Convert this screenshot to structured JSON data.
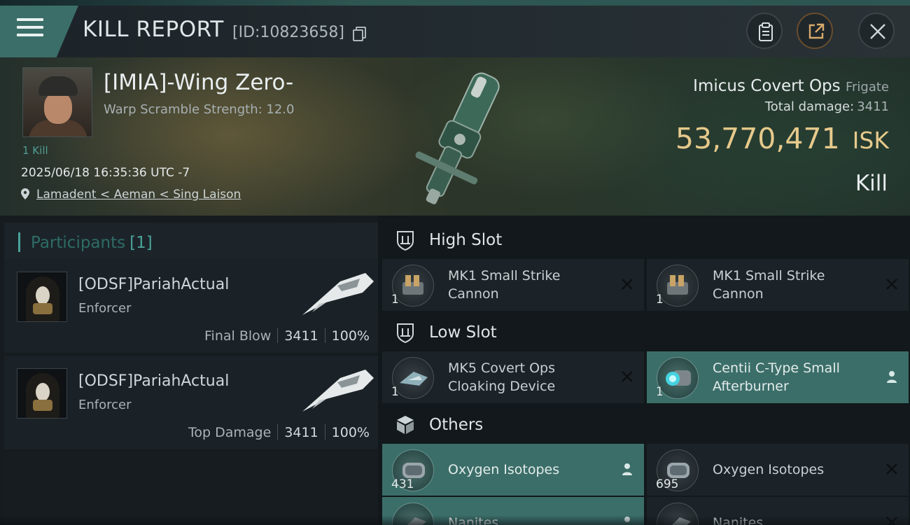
{
  "header": {
    "title": "KILL REPORT",
    "report_id": "[ID:10823658]"
  },
  "victim": {
    "name": "[IMIA]-Wing Zero-",
    "warp_scramble": "Warp Scramble Strength: 12.0",
    "kill_count": "1 Kill",
    "datetime": "2025/06/18 16:35:36 UTC -7",
    "location": "Lamadent < Aeman < Sing Laison"
  },
  "ship": {
    "name": "Imicus Covert Ops",
    "class": "Frigate",
    "damage_label": "Total damage:",
    "damage_value": "3411",
    "isk_value": "53,770,471",
    "isk_unit": "ISK",
    "result": "Kill"
  },
  "participants": {
    "label": "Participants",
    "count": "[1]",
    "rows": [
      {
        "name": "[ODSF]PariahActual",
        "corp": "Enforcer",
        "role": "Final Blow",
        "damage": "3411",
        "percent": "100%"
      },
      {
        "name": "[ODSF]PariahActual",
        "corp": "Enforcer",
        "role": "Top Damage",
        "damage": "3411",
        "percent": "100%"
      }
    ]
  },
  "slots": {
    "high": {
      "label": "High Slot",
      "items": [
        {
          "name": "MK1 Small Strike Cannon",
          "qty": "1",
          "status": "destroyed",
          "highlight": false
        },
        {
          "name": "MK1 Small Strike Cannon",
          "qty": "1",
          "status": "destroyed",
          "highlight": false
        }
      ]
    },
    "low": {
      "label": "Low Slot",
      "items": [
        {
          "name": "MK5 Covert Ops Cloaking Device",
          "qty": "1",
          "status": "destroyed",
          "highlight": false
        },
        {
          "name": "Centii C-Type Small Afterburner",
          "qty": "1",
          "status": "dropped",
          "highlight": true
        }
      ]
    },
    "others": {
      "label": "Others",
      "items": [
        {
          "name": "Oxygen Isotopes",
          "qty": "431",
          "status": "dropped",
          "highlight": true
        },
        {
          "name": "Oxygen Isotopes",
          "qty": "695",
          "status": "destroyed",
          "highlight": false
        },
        {
          "name": "Nanites",
          "qty": "",
          "status": "dropped",
          "highlight": true
        },
        {
          "name": "Nanites",
          "qty": "",
          "status": "destroyed",
          "highlight": false
        }
      ]
    }
  },
  "colors": {
    "accent": "#3c6e69",
    "isk": "#e6c98b",
    "participants_accent": "#4aa39a"
  },
  "icons": [
    "menu-icon",
    "copy-icon",
    "clipboard-icon",
    "share-icon",
    "close-icon",
    "location-pin-icon",
    "shield-icon",
    "cube-icon",
    "destroyed-x-icon",
    "dropped-person-icon"
  ]
}
